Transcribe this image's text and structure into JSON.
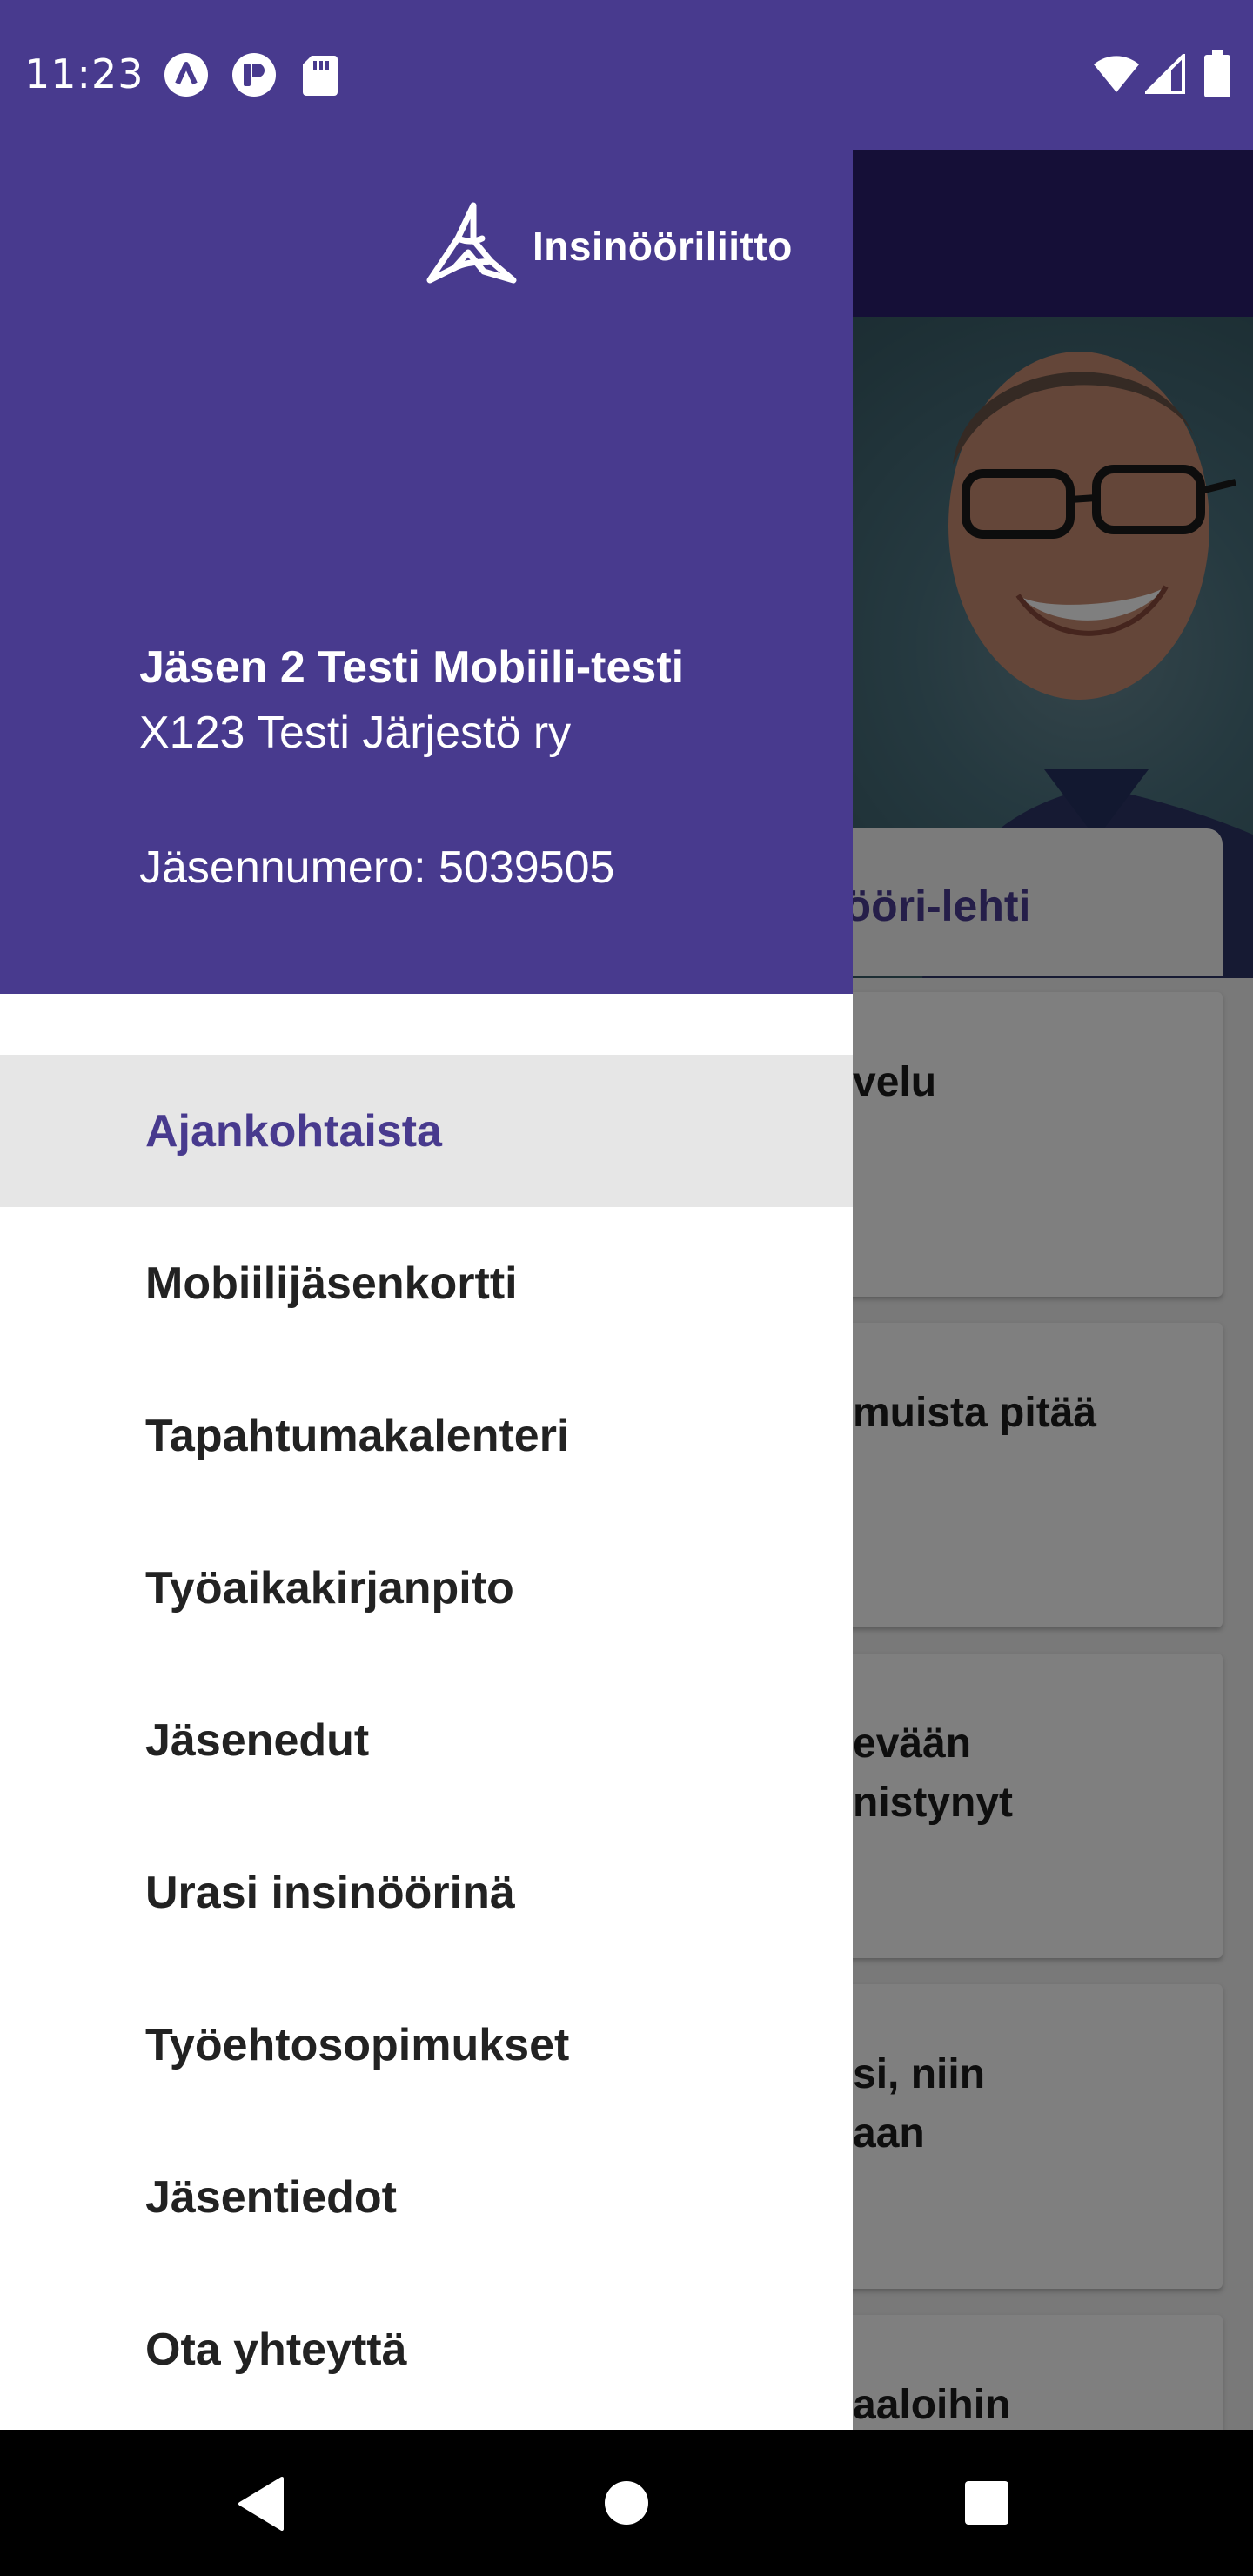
{
  "status_bar": {
    "time": "11:23",
    "left_icons": [
      "app-icon-a",
      "app-icon-p",
      "sd-card-icon"
    ],
    "right_icons": [
      "wifi-icon",
      "signal-icon",
      "battery-icon"
    ]
  },
  "colors": {
    "primary": "#483a8e",
    "app_bar_dark": "#2a1f6e",
    "active_item_bg": "#e6e6e6",
    "text_dark": "#222222"
  },
  "background_app": {
    "tab_label": "nööri-lehti",
    "cards": [
      "velu",
      "muista pitää",
      "evään\nnistynyt",
      "si, niin\naan",
      "aaloihin"
    ]
  },
  "drawer": {
    "logo_text": "Insinööriliitto",
    "member_name": "Jäsen 2 Testi Mobiili-testi",
    "member_org": "X123 Testi Järjestö ry",
    "member_number": "Jäsennumero: 5039505",
    "items": [
      {
        "label": "Ajankohtaista",
        "active": true
      },
      {
        "label": "Mobiilijäsenkortti"
      },
      {
        "label": "Tapahtumakalenteri"
      },
      {
        "label": "Työaikakirjanpito"
      },
      {
        "label": "Jäsenedut"
      },
      {
        "label": "Urasi insinöörinä"
      },
      {
        "label": "Työehtosopimukset"
      },
      {
        "label": "Jäsentiedot"
      },
      {
        "label": "Ota yhteyttä"
      }
    ]
  },
  "nav_bar": {
    "buttons": [
      "back-icon",
      "home-icon",
      "recents-icon"
    ]
  }
}
